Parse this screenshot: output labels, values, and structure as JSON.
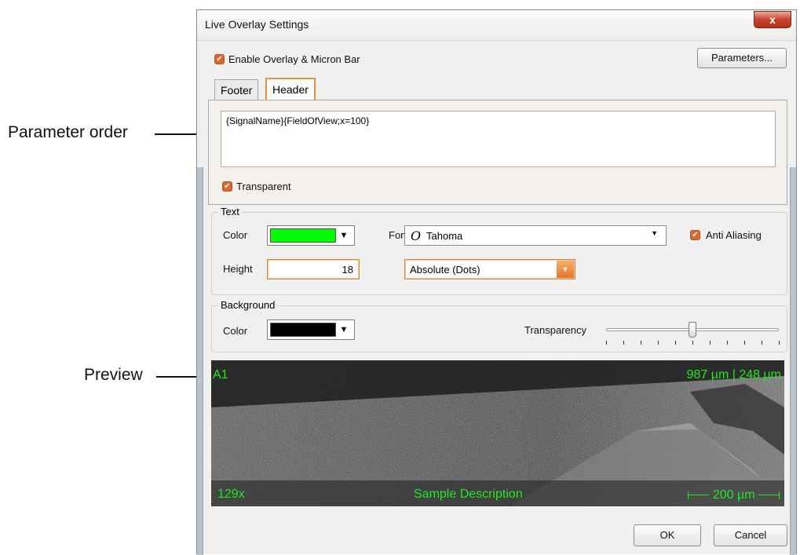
{
  "callouts": {
    "parameter_order": "Parameter order",
    "preview": "Preview"
  },
  "window": {
    "title": "Live Overlay Settings",
    "close_glyph": "x"
  },
  "overlay": {
    "enable_label": "Enable Overlay & Micron Bar",
    "enable_checked": true,
    "parameters_button": "Parameters..."
  },
  "tabs": [
    {
      "label": "Footer",
      "active": false
    },
    {
      "label": "Header",
      "active": true
    }
  ],
  "header_panel": {
    "template_text": "{SignalName}{FieldOfView;x=100}",
    "transparent_label": "Transparent",
    "transparent_checked": true
  },
  "text_group": {
    "title": "Text",
    "color_label": "Color",
    "color_value": "#00ff00",
    "font_label": "Font",
    "font_value": "Tahoma",
    "font_icon": "opentype-font-icon",
    "anti_aliasing_label": "Anti Aliasing",
    "anti_aliasing_checked": true,
    "height_label": "Height",
    "height_value": "18",
    "height_units": "Absolute (Dots)"
  },
  "background_group": {
    "title": "Background",
    "color_label": "Color",
    "color_value": "#000000",
    "transparency_label": "Transparency",
    "transparency_level": 0.5,
    "tick_count": 11
  },
  "preview": {
    "top_left": "A1",
    "top_right": "987 µm | 248 µm",
    "bottom_left": "129x",
    "bottom_center": "Sample Description",
    "bottom_right": "200 µm"
  },
  "buttons": {
    "ok": "OK",
    "cancel": "Cancel"
  },
  "colors": {
    "accent": "#e8903c",
    "overlay_text": "#1eea1e"
  }
}
